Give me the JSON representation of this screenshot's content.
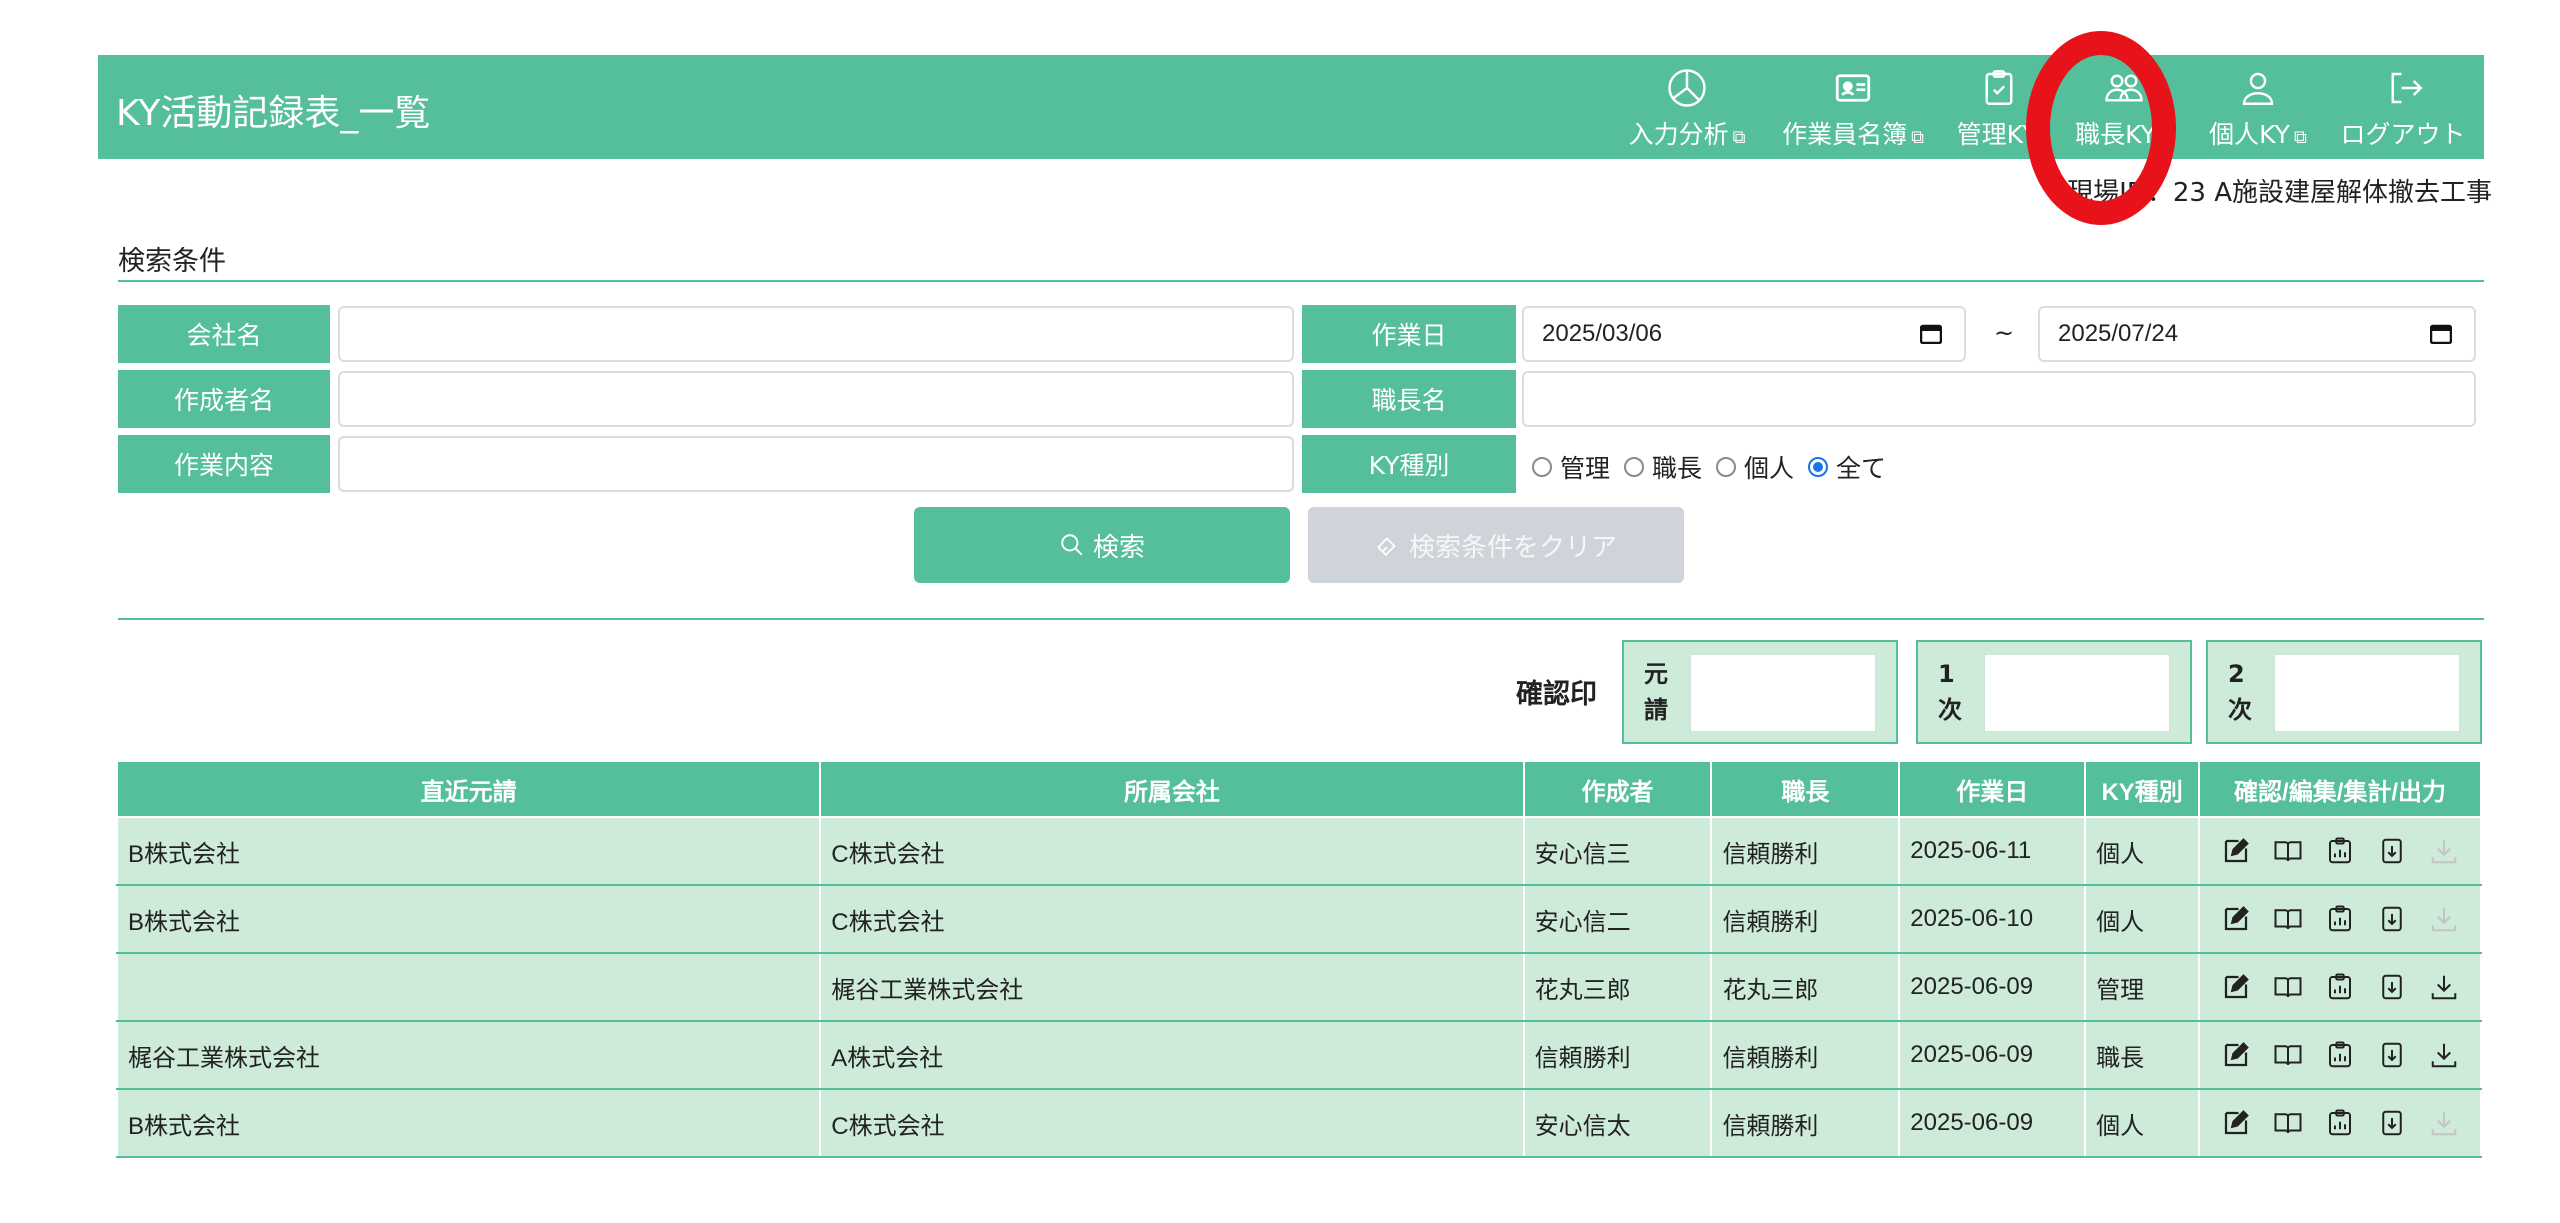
{
  "app": {
    "title": "KY活動記録表_一覧"
  },
  "nav": [
    {
      "label": "入力分析",
      "icon": "pie-chart-icon",
      "external": "⧉"
    },
    {
      "label": "作業員名簿",
      "icon": "id-card-icon",
      "external": "⧉"
    },
    {
      "label": "管理KY",
      "icon": "clipboard-check-icon",
      "external": ""
    },
    {
      "label": "職長KY",
      "icon": "people-icon",
      "external": "⧉"
    },
    {
      "label": "個人KY",
      "icon": "person-icon",
      "external": "⧉"
    },
    {
      "label": "ログアウト",
      "icon": "logout-icon",
      "external": ""
    }
  ],
  "site": {
    "text": "現場ID：23 A施設建屋解体撤去工事"
  },
  "search": {
    "title": "検索条件",
    "labels": {
      "company": "会社名",
      "author": "作成者名",
      "content": "作業内容",
      "work_date": "作業日",
      "foreman": "職長名",
      "ky_type": "KY種別"
    },
    "values": {
      "company": "",
      "author": "",
      "content": "",
      "date_from": "2025/03/06",
      "date_to": "2025/07/24",
      "foreman": ""
    },
    "range_sep": "~",
    "ky_options": [
      {
        "label": "管理",
        "checked": false
      },
      {
        "label": "職長",
        "checked": false
      },
      {
        "label": "個人",
        "checked": false
      },
      {
        "label": "全て",
        "checked": true
      }
    ],
    "search_button": "検索",
    "clear_button": "検索条件をクリア"
  },
  "stamps": {
    "label": "確認印",
    "boxes": [
      {
        "tag": "元\n請"
      },
      {
        "tag": "1\n次"
      },
      {
        "tag": "2\n次"
      }
    ]
  },
  "table": {
    "headers": [
      "直近元請",
      "所属会社",
      "作成者",
      "職長",
      "作業日",
      "KY種別",
      "確認/編集/集計/出力"
    ],
    "rows": [
      {
        "prime": "B株式会社",
        "company": "C株式会社",
        "author": "安心信三",
        "foreman": "信頼勝利",
        "date": "2025-06-11",
        "type": "個人",
        "download_enabled": false
      },
      {
        "prime": "B株式会社",
        "company": "C株式会社",
        "author": "安心信二",
        "foreman": "信頼勝利",
        "date": "2025-06-10",
        "type": "個人",
        "download_enabled": false
      },
      {
        "prime": "",
        "company": "梶谷工業株式会社",
        "author": "花丸三郎",
        "foreman": "花丸三郎",
        "date": "2025-06-09",
        "type": "管理",
        "download_enabled": true
      },
      {
        "prime": "梶谷工業株式会社",
        "company": "A株式会社",
        "author": "信頼勝利",
        "foreman": "信頼勝利",
        "date": "2025-06-09",
        "type": "職長",
        "download_enabled": true
      },
      {
        "prime": "B株式会社",
        "company": "C株式会社",
        "author": "安心信太",
        "foreman": "信頼勝利",
        "date": "2025-06-09",
        "type": "個人",
        "download_enabled": false
      }
    ]
  },
  "colors": {
    "accent": "#55be9b",
    "row_bg": "#cdebd8",
    "highlight": "#e8131a",
    "radio": "#1a73e8",
    "clear_btn": "#cfd3da"
  }
}
